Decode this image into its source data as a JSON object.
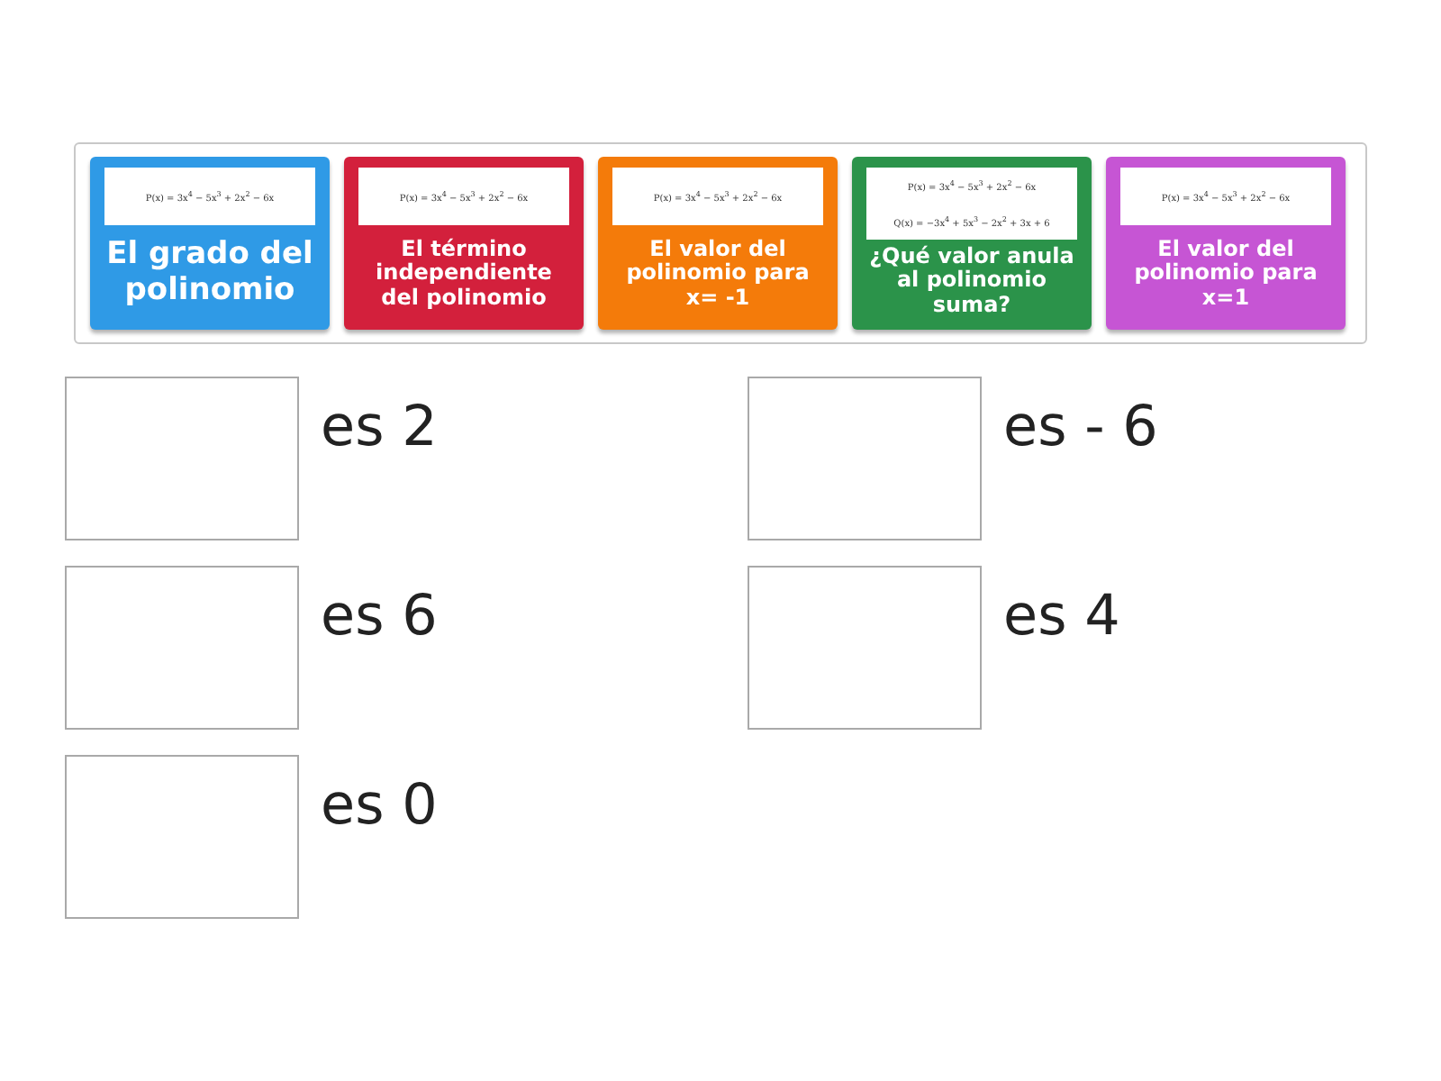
{
  "cards": [
    {
      "color": "#2f9ae6",
      "formulas": [
        "P(x) = 3x$^{4}$ − 5x$^{3}$ + 2x$^{2}$ − 6x"
      ],
      "label": "El grado del polinomio"
    },
    {
      "color": "#d3203c",
      "formulas": [
        "P(x) = 3x$^{4}$ − 5x$^{3}$ + 2x$^{2}$ − 6x"
      ],
      "label": "El término independiente del polinomio"
    },
    {
      "color": "#f47b0a",
      "formulas": [
        "P(x) = 3x$^{4}$ − 5x$^{3}$ + 2x$^{2}$ − 6x"
      ],
      "label": "El valor del polinomio para x= -1"
    },
    {
      "color": "#2b934a",
      "formulas": [
        "P(x) = 3x$^{4}$ − 5x$^{3}$ + 2x$^{2}$ − 6x",
        "Q(x) = −3x$^{4}$ + 5x$^{3}$ − 2x$^{2}$ + 3x + 6"
      ],
      "label": "¿Qué valor anula al polinomio suma?"
    },
    {
      "color": "#c655d4",
      "formulas": [
        "P(x) = 3x$^{4}$ − 5x$^{3}$ + 2x$^{2}$ − 6x"
      ],
      "label": "El valor del polinomio para x=1"
    }
  ],
  "answers": [
    {
      "text": "es 2"
    },
    {
      "text": "es - 6"
    },
    {
      "text": "es 6"
    },
    {
      "text": "es 4"
    },
    {
      "text": "es 0"
    }
  ]
}
